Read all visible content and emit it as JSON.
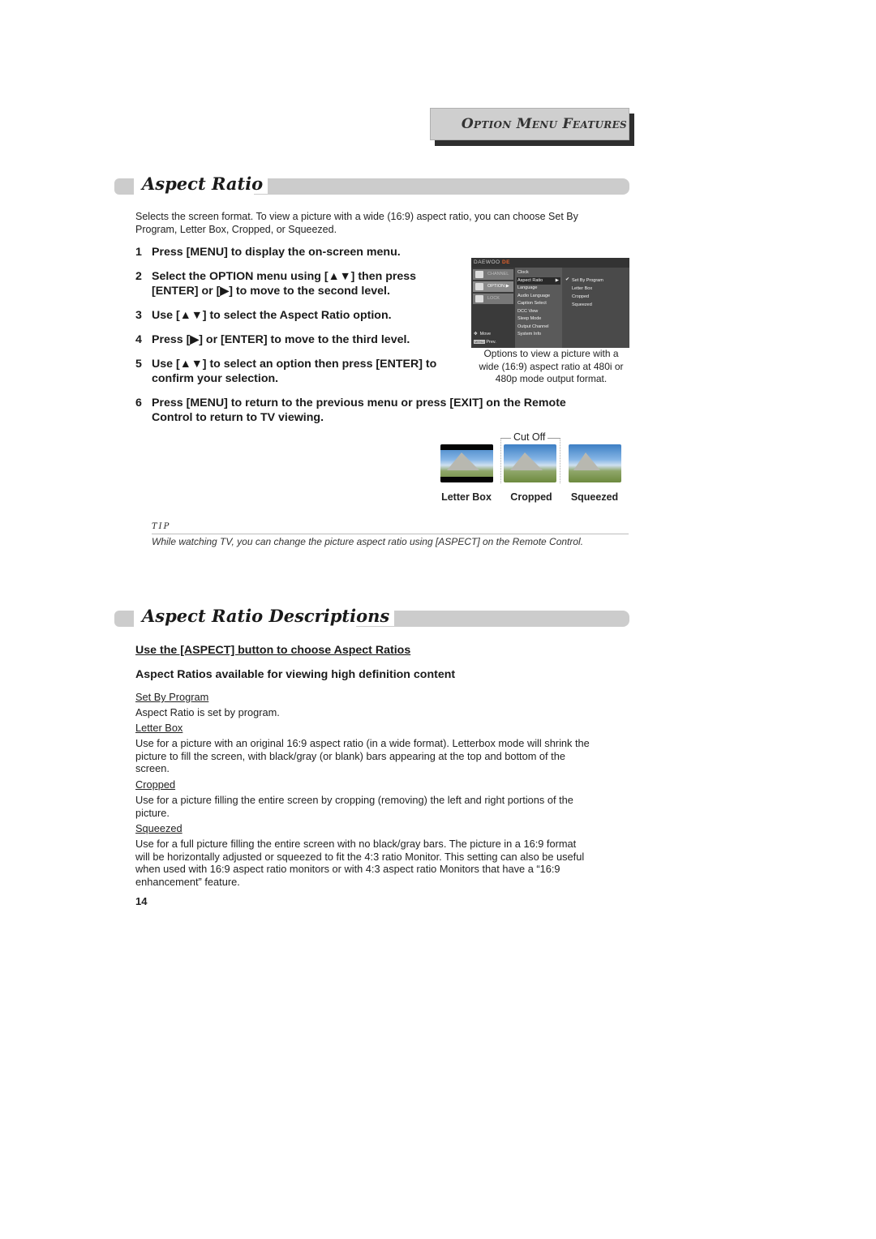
{
  "header": {
    "badge": "Option Menu Features"
  },
  "section1": {
    "title": "Aspect Ratio",
    "intro_line1": "Selects the screen format. To view a picture with a wide (16:9) aspect ratio, you can choose Set By",
    "intro_line2": "Program, Letter Box, Cropped, or Squeezed.",
    "steps": [
      {
        "num": "1",
        "lines": [
          "Press [MENU] to display the on-screen menu."
        ]
      },
      {
        "num": "2",
        "lines": [
          "Select the OPTION menu using [▲▼] then press",
          "[ENTER] or [▶] to move to the second level."
        ]
      },
      {
        "num": "3",
        "lines": [
          "Use [▲▼] to select the Aspect Ratio option."
        ]
      },
      {
        "num": "4",
        "lines": [
          "Press [▶] or [ENTER] to move to the third level."
        ]
      },
      {
        "num": "5",
        "lines": [
          "Use [▲▼] to select an option then press [ENTER] to",
          "confirm your selection."
        ]
      },
      {
        "num": "6",
        "lines": [
          "Press [MENU] to return to the previous menu or press [EXIT] on the Remote",
          "Control to return to TV viewing."
        ]
      }
    ]
  },
  "tv_menu": {
    "brand": "DAEWOO",
    "brand_suffix": "DE",
    "categories": [
      "CHANNEL",
      "OPTION",
      "LOCK"
    ],
    "active_category": "OPTION",
    "options": [
      "Clock",
      "Aspect Ratio",
      "Language",
      "Audio Language",
      "Caption Select",
      "DCC View",
      "Sleep Mode",
      "Output Channel",
      "System Info"
    ],
    "selected_option": "Aspect Ratio",
    "sub_options": [
      "Set By Program",
      "Letter Box",
      "Cropped",
      "Squeezed"
    ],
    "checked_sub_option": "Set By Program",
    "footer": {
      "move": "Move",
      "menu_key": "MENU",
      "prev": "Prev."
    }
  },
  "menu_caption": {
    "line1": "Options to view a picture with a",
    "line2": "wide (16:9) aspect ratio at 480i or",
    "line3": "480p mode output format."
  },
  "illustrations": {
    "cut_off_label": "Cut Off",
    "labels": [
      "Letter Box",
      "Cropped",
      "Squeezed"
    ]
  },
  "tip": {
    "label": "TIP",
    "text": "While watching TV, you can change the picture aspect ratio using [ASPECT] on the Remote Control."
  },
  "section2": {
    "title": "Aspect Ratio Descriptions",
    "subhead1": "Use the [ASPECT] button to choose Aspect Ratios",
    "subhead2": "Aspect Ratios available for viewing high definition content",
    "items": [
      {
        "term": "Set By Program",
        "lines": [
          "Aspect Ratio is set by program."
        ]
      },
      {
        "term": "Letter Box",
        "lines": [
          "Use for a picture with an original 16:9 aspect ratio (in a wide format). Letterbox mode will shrink the",
          "picture to fill the screen, with black/gray (or blank) bars appearing at the top and bottom of the",
          "screen."
        ]
      },
      {
        "term": "Cropped",
        "lines": [
          "Use for a picture filling the entire screen by cropping (removing) the left and right portions of the",
          "picture."
        ]
      },
      {
        "term": "Squeezed",
        "lines": [
          "Use for a full picture filling the entire screen with no black/gray bars. The picture in a 16:9 format",
          "will be horizontally adjusted or squeezed to fit the 4:3 ratio Monitor. This setting can also be useful",
          "when used with 16:9 aspect ratio monitors or with 4:3 aspect ratio Monitors that have a “16:9",
          "enhancement” feature."
        ]
      }
    ]
  },
  "page_number": "14"
}
